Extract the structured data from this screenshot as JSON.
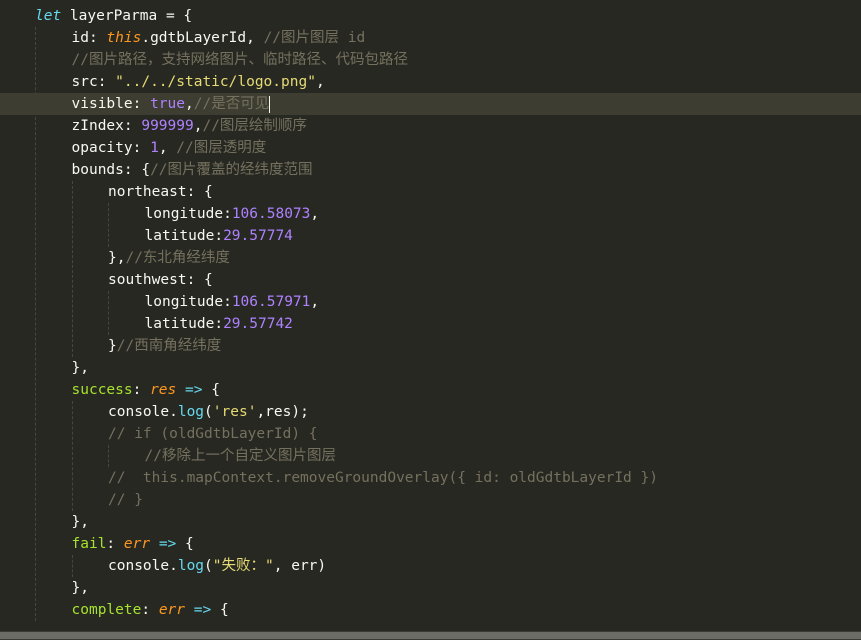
{
  "editor": {
    "lines": [
      {
        "tokens": [
          {
            "t": "let",
            "c": "kw-it"
          },
          {
            "t": " layerParma = {",
            "c": "prop"
          }
        ]
      },
      {
        "tokens": [
          {
            "t": "id: ",
            "c": "prop"
          },
          {
            "t": "this",
            "c": "this"
          },
          {
            "t": ".gdtbLayerId, ",
            "c": "prop"
          },
          {
            "t": "//图片图层 id",
            "c": "cmt"
          }
        ]
      },
      {
        "tokens": [
          {
            "t": "//图片路径，支持网络图片、临时路径、代码包路径",
            "c": "cmt"
          }
        ]
      },
      {
        "tokens": [
          {
            "t": "src: ",
            "c": "prop"
          },
          {
            "t": "\"../../static/logo.png\"",
            "c": "str"
          },
          {
            "t": ",",
            "c": "prop"
          }
        ]
      },
      {
        "tokens": [
          {
            "t": "visible: ",
            "c": "prop"
          },
          {
            "t": "true",
            "c": "bool"
          },
          {
            "t": ",",
            "c": "prop"
          },
          {
            "t": "//是否可见",
            "c": "cmt"
          }
        ]
      },
      {
        "tokens": [
          {
            "t": "zIndex: ",
            "c": "prop"
          },
          {
            "t": "999999",
            "c": "num"
          },
          {
            "t": ",",
            "c": "prop"
          },
          {
            "t": "//图层绘制顺序",
            "c": "cmt"
          }
        ]
      },
      {
        "tokens": [
          {
            "t": "opacity: ",
            "c": "prop"
          },
          {
            "t": "1",
            "c": "num"
          },
          {
            "t": ", ",
            "c": "prop"
          },
          {
            "t": "//图层透明度",
            "c": "cmt"
          }
        ]
      },
      {
        "tokens": [
          {
            "t": "bounds: {",
            "c": "prop"
          },
          {
            "t": "//图片覆盖的经纬度范围",
            "c": "cmt"
          }
        ]
      },
      {
        "tokens": [
          {
            "t": "northeast: {",
            "c": "prop"
          }
        ]
      },
      {
        "tokens": [
          {
            "t": "longitude:",
            "c": "prop"
          },
          {
            "t": "106.58073",
            "c": "num"
          },
          {
            "t": ",",
            "c": "prop"
          }
        ]
      },
      {
        "tokens": [
          {
            "t": "latitude:",
            "c": "prop"
          },
          {
            "t": "29.57774",
            "c": "num"
          }
        ]
      },
      {
        "tokens": [
          {
            "t": "},",
            "c": "prop"
          },
          {
            "t": "//东北角经纬度",
            "c": "cmt"
          }
        ]
      },
      {
        "tokens": [
          {
            "t": "southwest: {",
            "c": "prop"
          }
        ]
      },
      {
        "tokens": [
          {
            "t": "longitude:",
            "c": "prop"
          },
          {
            "t": "106.57971",
            "c": "num"
          },
          {
            "t": ",",
            "c": "prop"
          }
        ]
      },
      {
        "tokens": [
          {
            "t": "latitude:",
            "c": "prop"
          },
          {
            "t": "29.57742",
            "c": "num"
          }
        ]
      },
      {
        "tokens": [
          {
            "t": "}",
            "c": "prop"
          },
          {
            "t": "//西南角经纬度",
            "c": "cmt"
          }
        ]
      },
      {
        "tokens": [
          {
            "t": "},",
            "c": "prop"
          }
        ]
      },
      {
        "tokens": [
          {
            "t": "success",
            "c": "fn"
          },
          {
            "t": ": ",
            "c": "prop"
          },
          {
            "t": "res",
            "c": "param"
          },
          {
            "t": " ",
            "c": "prop"
          },
          {
            "t": "=>",
            "c": "method"
          },
          {
            "t": " {",
            "c": "prop"
          }
        ]
      },
      {
        "tokens": [
          {
            "t": "console.",
            "c": "prop"
          },
          {
            "t": "log",
            "c": "method"
          },
          {
            "t": "(",
            "c": "prop"
          },
          {
            "t": "'res'",
            "c": "str"
          },
          {
            "t": ",res);",
            "c": "prop"
          }
        ]
      },
      {
        "tokens": [
          {
            "t": "// if (oldGdtbLayerId) {",
            "c": "cmt"
          }
        ]
      },
      {
        "tokens": [
          {
            "t": "//移除上一个自定义图片图层",
            "c": "cmt"
          }
        ]
      },
      {
        "tokens": [
          {
            "t": "//  this.mapContext.removeGroundOverlay({ id: oldGdtbLayerId })",
            "c": "cmt"
          }
        ]
      },
      {
        "tokens": [
          {
            "t": "// }",
            "c": "cmt"
          }
        ]
      },
      {
        "tokens": [
          {
            "t": "},",
            "c": "prop"
          }
        ]
      },
      {
        "tokens": [
          {
            "t": "fail",
            "c": "fn"
          },
          {
            "t": ": ",
            "c": "prop"
          },
          {
            "t": "err",
            "c": "param"
          },
          {
            "t": " ",
            "c": "prop"
          },
          {
            "t": "=>",
            "c": "method"
          },
          {
            "t": " {",
            "c": "prop"
          }
        ]
      },
      {
        "tokens": [
          {
            "t": "console.",
            "c": "prop"
          },
          {
            "t": "log",
            "c": "method"
          },
          {
            "t": "(",
            "c": "prop"
          },
          {
            "t": "\"失败：\"",
            "c": "str"
          },
          {
            "t": ", err)",
            "c": "prop"
          }
        ]
      },
      {
        "tokens": [
          {
            "t": "},",
            "c": "prop"
          }
        ]
      },
      {
        "tokens": [
          {
            "t": "complete",
            "c": "fn"
          },
          {
            "t": ": ",
            "c": "prop"
          },
          {
            "t": "err",
            "c": "param"
          },
          {
            "t": " ",
            "c": "prop"
          },
          {
            "t": "=>",
            "c": "method"
          },
          {
            "t": " {",
            "c": "prop"
          }
        ]
      }
    ]
  },
  "colors": {
    "background": "#272822",
    "active_line": "#3e3d32",
    "foreground": "#f8f8f2",
    "comment": "#75715e",
    "string": "#e6db74",
    "number": "#ae81ff",
    "keyword": "#66d9ef",
    "function": "#a6e22e",
    "parameter": "#fd971f"
  }
}
